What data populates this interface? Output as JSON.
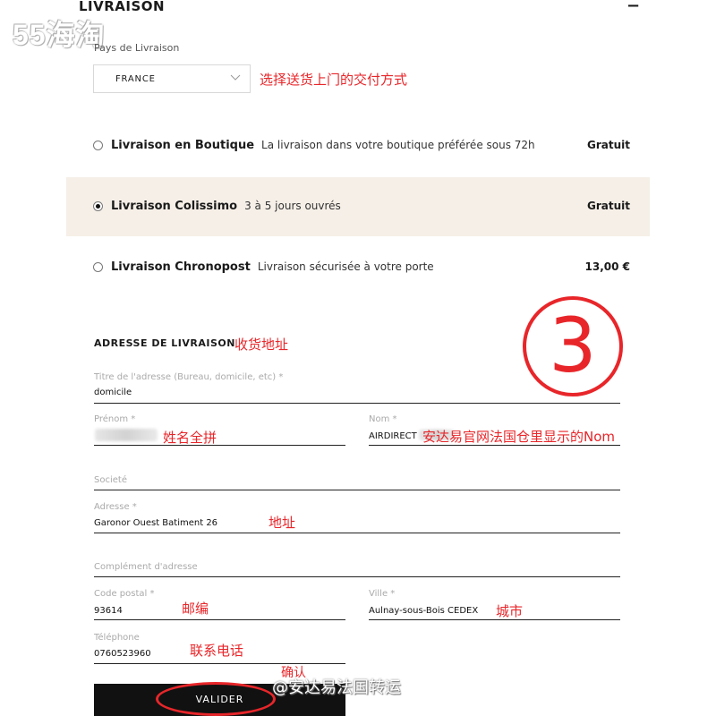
{
  "watermark": "55海淘",
  "section": {
    "title": "LIVRAISON",
    "collapse_symbol": "−"
  },
  "country": {
    "label": "Pays de Livraison",
    "value": "FRANCE",
    "annotation": "选择送货上门的交付方式"
  },
  "shipping_options": [
    {
      "name": "Livraison en Boutique",
      "desc": "La livraison dans votre boutique préférée sous 72h",
      "price": "Gratuit",
      "selected": false
    },
    {
      "name": "Livraison Colissimo",
      "desc": "3 à 5 jours ouvrés",
      "price": "Gratuit",
      "selected": true
    },
    {
      "name": "Livraison Chronopost",
      "desc": "Livraison sécurisée à votre porte",
      "price": "13,00 €",
      "selected": false
    }
  ],
  "step_marker": "3",
  "address": {
    "title": "ADRESSE DE LIVRAISON",
    "title_annotation": "收货地址",
    "address_title": {
      "label": "Titre de l'adresse (Bureau, domicile, etc) *",
      "value": "domicile"
    },
    "prenom": {
      "label": "Prénom *",
      "value": "",
      "annotation": "姓名全拼"
    },
    "nom": {
      "label": "Nom *",
      "value": "AIRDIRECT",
      "annotation": "安达易官网法国仓里显示的Nom"
    },
    "societe": {
      "label": "Societé",
      "value": ""
    },
    "adresse": {
      "label": "Adresse *",
      "value": "Garonor Ouest Batiment 26",
      "annotation": "地址"
    },
    "complement": {
      "label": "Complément d'adresse",
      "value": ""
    },
    "code_postal": {
      "label": "Code postal *",
      "value": "93614",
      "annotation": "邮编"
    },
    "ville": {
      "label": "Ville *",
      "value": "Aulnay-sous-Bois CEDEX",
      "annotation": "城市"
    },
    "telephone": {
      "label": "Téléphone",
      "value": "0760523960",
      "annotation": "联系电话"
    }
  },
  "submit": {
    "label": "VALIDER",
    "annotation": "确认"
  },
  "credit": "@安达易法国转运",
  "colors": {
    "accent_red": "#e8262a",
    "selected_row": "#f5efe7",
    "button": "#111111"
  }
}
